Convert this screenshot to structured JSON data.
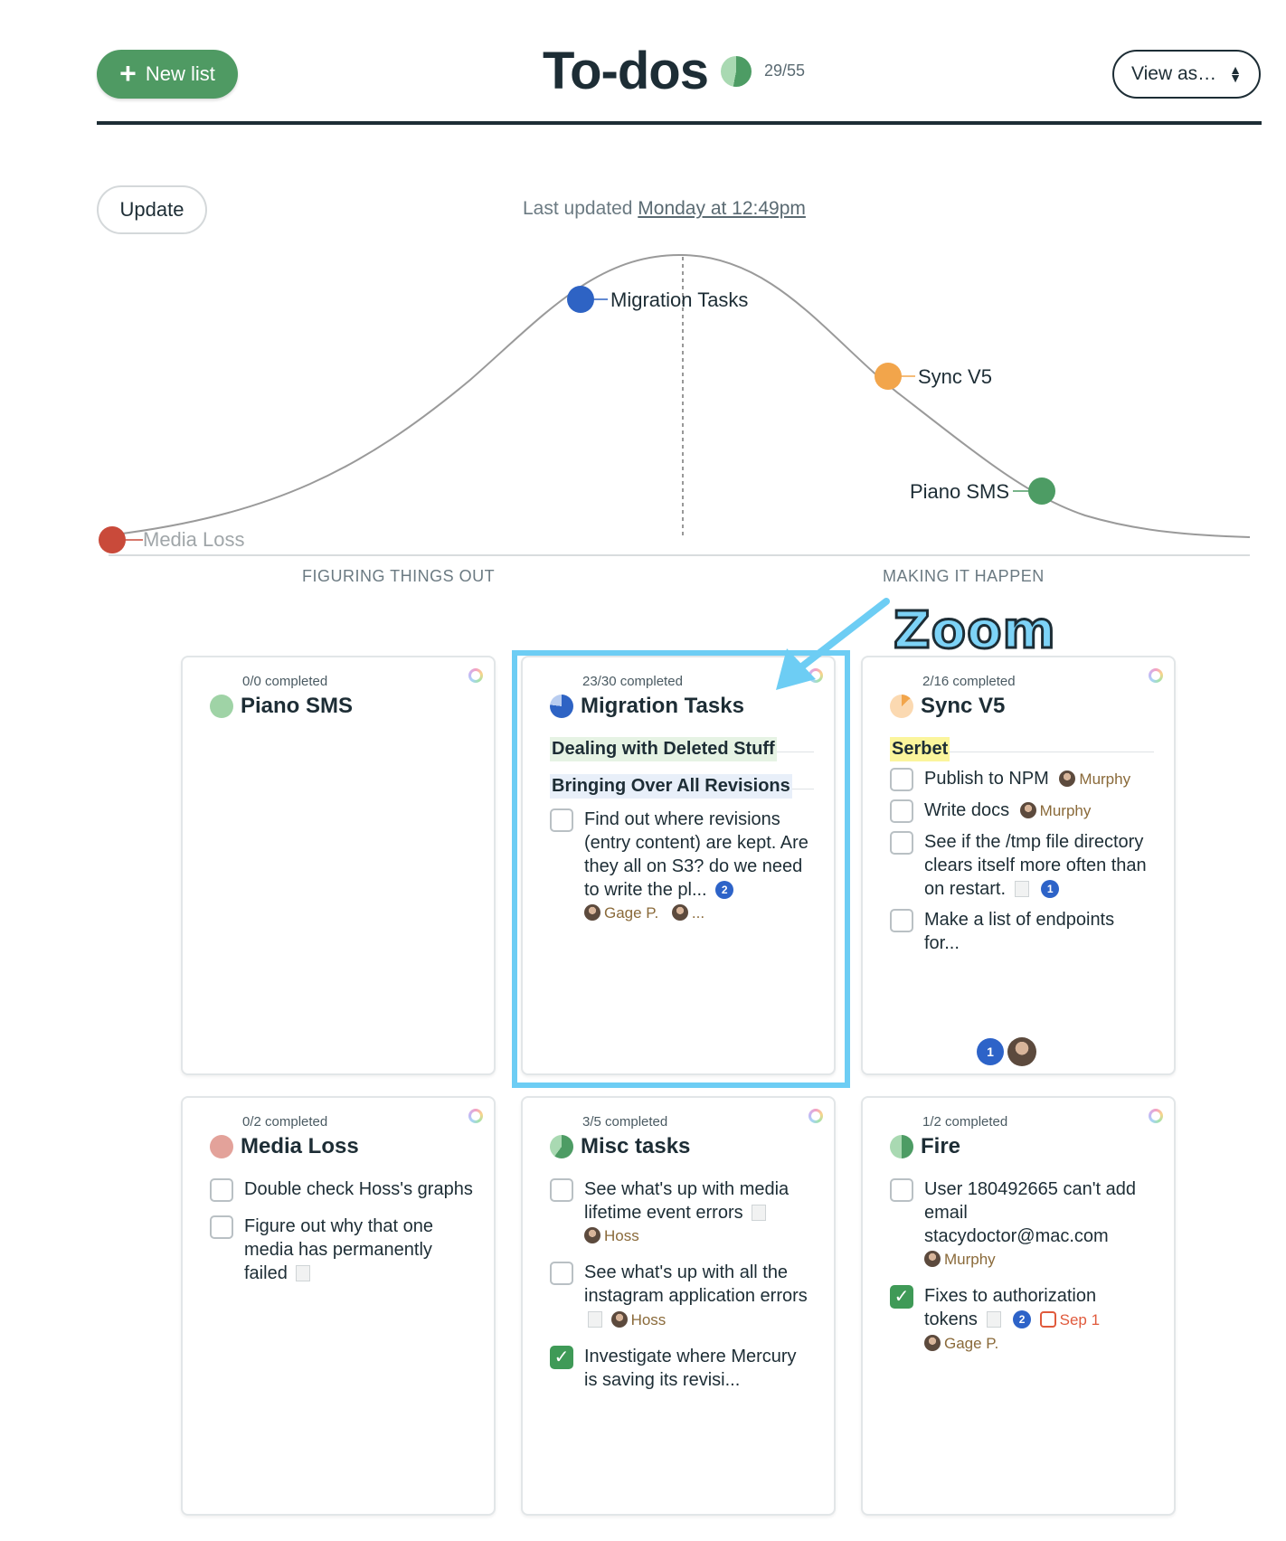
{
  "header": {
    "new_list_label": "New list",
    "title": "To-dos",
    "progress": "29/55",
    "view_as_label": "View as…"
  },
  "update": {
    "button_label": "Update",
    "last_updated_prefix": "Last updated",
    "last_updated_when": "Monday at 12:49pm"
  },
  "hill": {
    "phases": [
      "FIGURING THINGS OUT",
      "MAKING IT HAPPEN"
    ],
    "points": [
      {
        "label": "Media Loss",
        "color": "#c94a3a"
      },
      {
        "label": "Migration Tasks",
        "color": "#2e63c4"
      },
      {
        "label": "Sync V5",
        "color": "#f2a54b"
      },
      {
        "label": "Piano SMS",
        "color": "#4d9c64"
      }
    ]
  },
  "annotation": {
    "zoom_label": "Zoom"
  },
  "cards": [
    {
      "completed": "0/0 completed",
      "name": "Piano SMS",
      "pie_color": "#9fd3a6",
      "fraction": 0
    },
    {
      "completed": "23/30 completed",
      "name": "Migration Tasks",
      "pie_color": "#2e63c4",
      "fraction": 0.77,
      "groups": [
        "Dealing with Deleted Stuff",
        "Bringing Over All Revisions"
      ],
      "todos": [
        {
          "text": "Find out where revisions (entry content) are kept. Are they all on S3? do we need to write the pl...",
          "badge": "2",
          "assignee": "Gage P.",
          "more": "..."
        }
      ]
    },
    {
      "completed": "2/16 completed",
      "name": "Sync V5",
      "pie_color": "#f6c28c",
      "fraction": 0.13,
      "groups": [
        "Serbet"
      ],
      "todos": [
        {
          "text": "Publish to NPM",
          "assignee": "Murphy"
        },
        {
          "text": "Write docs",
          "assignee": "Murphy"
        },
        {
          "text": "See if the /tmp file directory clears itself more often than on restart.",
          "badge": "1"
        },
        {
          "text": "Make a list of endpoints for..."
        }
      ],
      "footer_badge": "1"
    },
    {
      "completed": "0/2 completed",
      "name": "Media Loss",
      "pie_color": "#e3a29a",
      "fraction": 0,
      "todos": [
        {
          "text": "Double check Hoss's graphs"
        },
        {
          "text": "Figure out why that one media has permanently failed"
        }
      ]
    },
    {
      "completed": "3/5 completed",
      "name": "Misc tasks",
      "pie_color": "#4d9c64",
      "fraction": 0.6,
      "todos": [
        {
          "text": "See what's up with media lifetime event errors",
          "assignee": "Hoss"
        },
        {
          "text": "See what's up with all the instagram application errors",
          "assignee": "Hoss"
        },
        {
          "text": "Investigate where Mercury is saving its revisi...",
          "done": true
        }
      ]
    },
    {
      "completed": "1/2 completed",
      "name": "Fire",
      "pie_color": "#4d9c64",
      "fraction": 0.5,
      "todos": [
        {
          "text": "User 180492665 can't add email stacydoctor@mac.com",
          "assignee": "Murphy"
        },
        {
          "text": "Fixes to authorization tokens",
          "badge": "2",
          "due": "Sep 1",
          "assignee": "Gage P.",
          "done": true
        }
      ]
    }
  ]
}
